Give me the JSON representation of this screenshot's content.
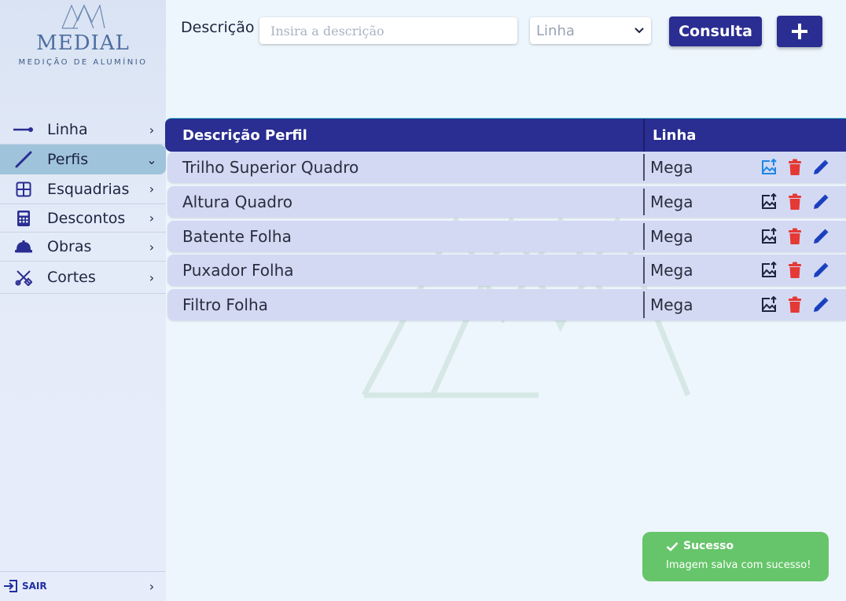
{
  "brand": {
    "name": "MEDIAL",
    "tagline": "MEDIÇÃO DE ALUMÍNIO"
  },
  "sidebar": {
    "items": [
      {
        "label": "Linha",
        "icon": "line-icon",
        "chevron": "right"
      },
      {
        "label": "Perfis",
        "icon": "slash-pencil-icon",
        "chevron": "down",
        "active": true
      },
      {
        "label": "Esquadrias",
        "icon": "window-grid-icon",
        "chevron": "right"
      },
      {
        "label": "Descontos",
        "icon": "calculator-icon",
        "chevron": "right"
      },
      {
        "label": "Obras",
        "icon": "hard-hat-icon",
        "chevron": "right"
      },
      {
        "label": "Cortes",
        "icon": "tools-icon",
        "chevron": "right"
      }
    ],
    "logout_label": "SAIR"
  },
  "search": {
    "label": "Descrição",
    "placeholder": "Insira a descrição",
    "value": ""
  },
  "linha_select": {
    "selected": "Linha"
  },
  "buttons": {
    "consulta_label": "Consulta",
    "add_icon": "plus-icon"
  },
  "table": {
    "headers": [
      "Descrição Perfil",
      "Linha"
    ],
    "rows": [
      {
        "descricao": "Trilho Superior Quadro",
        "linha": "Mega",
        "image_highlighted": true
      },
      {
        "descricao": "Altura Quadro",
        "linha": "Mega",
        "image_highlighted": false
      },
      {
        "descricao": "Batente Folha",
        "linha": "Mega",
        "image_highlighted": false
      },
      {
        "descricao": "Puxador Folha",
        "linha": "Mega",
        "image_highlighted": false
      },
      {
        "descricao": "Filtro Folha",
        "linha": "Mega",
        "image_highlighted": false
      }
    ],
    "action_icons": [
      "image-upload-icon",
      "trash-icon",
      "pencil-icon"
    ]
  },
  "toast": {
    "title": "Sucesso",
    "message": "Imagem salva com sucesso!",
    "icon": "check-icon"
  },
  "colors": {
    "primary": "#2a2d91",
    "row_bg": "#d3d9f3",
    "active_nav": "#9fc3db",
    "delete": "#e53935",
    "edit": "#1a3fbf",
    "upload_highlight": "#1e88e5",
    "success": "#66c56a"
  }
}
